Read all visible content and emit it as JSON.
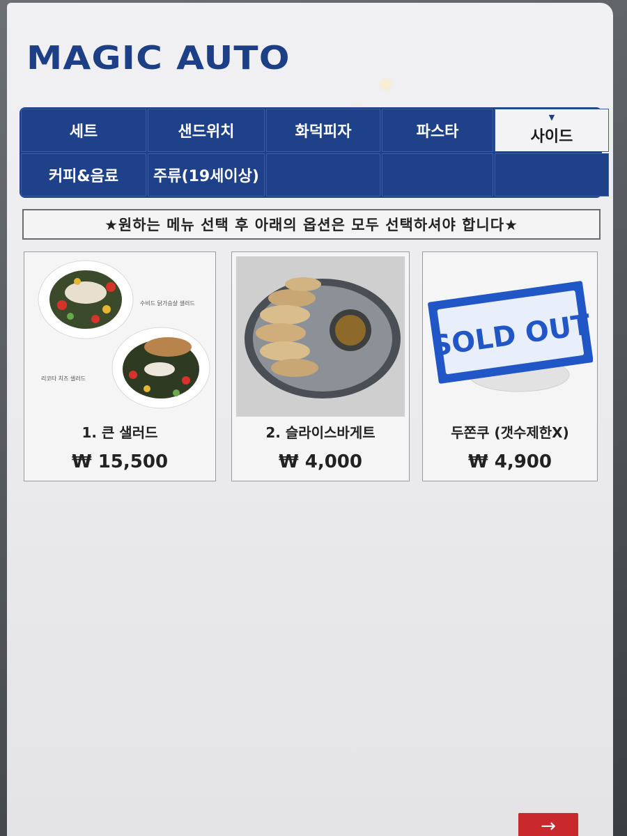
{
  "header": {
    "logo": "MAGIC AUTO"
  },
  "tabs": [
    {
      "label": "세트"
    },
    {
      "label": "샌드위치"
    },
    {
      "label": "화덕피자"
    },
    {
      "label": "파스타"
    },
    {
      "label": "사이드",
      "active": true
    },
    {
      "label": "커피&음료"
    },
    {
      "label": "주류(19세이상)"
    },
    {
      "label": ""
    },
    {
      "label": ""
    },
    {
      "label": ""
    }
  ],
  "notice": "★원하는 메뉴 선택 후 아래의 옵션은 모두 선택하셔야 합니다★",
  "menu_items": [
    {
      "name": "1. 큰 샐러드",
      "price": "₩ 15,500",
      "captions": [
        "수비드 닭가슴살 샐러드",
        "리코타 치즈 샐러드"
      ]
    },
    {
      "name": "2. 슬라이스바게트",
      "price": "₩ 4,000"
    },
    {
      "name": "두쫀쿠 (갯수제한X)",
      "price": "₩ 4,900",
      "stamp": "SOLD OUT"
    }
  ],
  "footer": {
    "next_symbol": "→"
  },
  "colors": {
    "brand_blue": "#1d3f85",
    "next_red": "#c9282d",
    "stamp_blue": "#2156c7"
  }
}
